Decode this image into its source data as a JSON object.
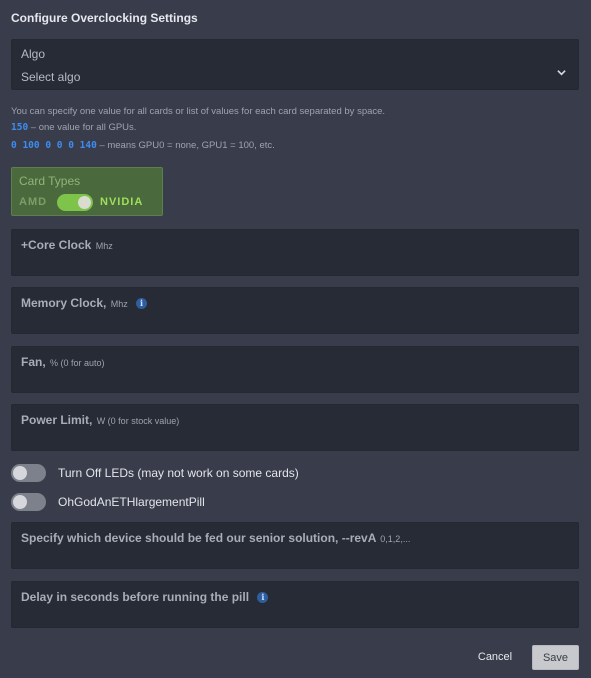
{
  "dialog": {
    "title": "Configure Overclocking Settings"
  },
  "algo": {
    "label": "Algo",
    "value": "Select algo"
  },
  "help": {
    "line1": "You can specify one value for all cards or list of values for each card separated by space.",
    "example1_code": "150",
    "example1_text": " – one value for all GPUs.",
    "example2_code": "0 100 0 0 0 140",
    "example2_text": " – means GPU0 = none, GPU1 = 100, etc."
  },
  "card_types": {
    "label": "Card Types",
    "left_option": "AMD",
    "right_option": "NVIDIA",
    "selected": "NVIDIA",
    "active_color": "#7ec34a"
  },
  "fields": {
    "core_clock": {
      "label": "+Core Clock",
      "unit": "Mhz",
      "value": ""
    },
    "memory_clock": {
      "label": "Memory Clock,",
      "unit": "Mhz",
      "value": "",
      "info_icon": "info-icon"
    },
    "fan": {
      "label": "Fan,",
      "unit": "% (0 for auto)",
      "value": ""
    },
    "power_limit": {
      "label": "Power Limit,",
      "unit": "W (0 for stock value)",
      "value": ""
    },
    "rev_a": {
      "label": "Specify which device should be fed our senior solution, --revA",
      "unit": "0,1,2,...",
      "value": ""
    },
    "pill_delay": {
      "label": "Delay in seconds before running the pill",
      "value": "",
      "info_icon": "info-icon"
    }
  },
  "toggles": {
    "leds": {
      "label": "Turn Off LEDs (may not work on some cards)",
      "on": false
    },
    "pill": {
      "label": "OhGodAnETHlargementPill",
      "on": false
    }
  },
  "footer": {
    "cancel_label": "Cancel",
    "save_label": "Save"
  },
  "colors": {
    "background": "#393d4b",
    "field_bg": "#272b36",
    "code_blue": "#3d8cf0",
    "info_blue": "#2f5e9e"
  }
}
